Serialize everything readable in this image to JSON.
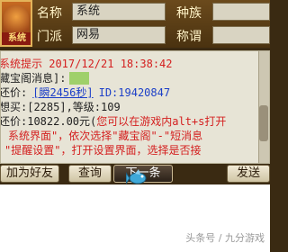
{
  "header": {
    "avatar_label": "系统",
    "name_label": "名称",
    "name_value": "系统",
    "race_label": "种族",
    "race_value": "",
    "sect_label": "门派",
    "sect_value": "网易",
    "title_label": "称谓",
    "title_value": ""
  },
  "messages": {
    "line1": "系统提示 2017/12/21 18:38:42",
    "line2_label": "藏宝阁消息]:",
    "line2_tail": "...",
    "line3_label": "还价:",
    "line3_link": "[瞬2456秒]",
    "line3_id": "ID:19420847",
    "line4": "想买:[2285],等级:109",
    "line5_price": "还价:10822.00元(",
    "line5_hint": "您可以在游戏内alt+s打开",
    "line6": "系统界面\"，依次选择\"藏宝阁\"-\"短消息",
    "line7": "\"提醒设置\"，打开设置界面，选择是否接"
  },
  "buttons": {
    "add_friend": "加为好友",
    "query": "查询",
    "next": "下一条",
    "send": "发送"
  },
  "footer": {
    "watermark": "头条号 / 九分游戏"
  }
}
